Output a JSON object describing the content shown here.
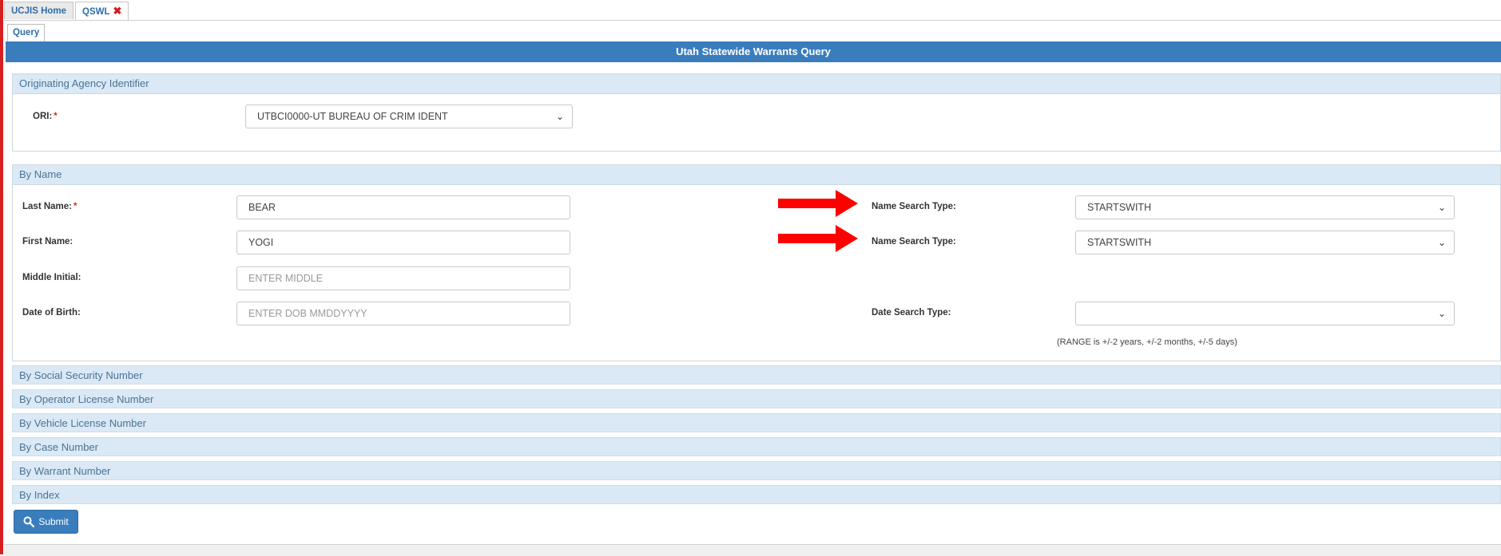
{
  "tabs": [
    {
      "label": "UCJIS Home"
    },
    {
      "label": "QSWL",
      "close": "✖"
    }
  ],
  "subtab": {
    "label": "Query"
  },
  "title": "Utah Statewide Warrants Query",
  "ori_section": {
    "header": "Originating Agency Identifier",
    "label": "ORI:",
    "value": "UTBCI0000-UT BUREAU OF CRIM IDENT"
  },
  "name_section": {
    "header": "By Name",
    "last_name": {
      "label": "Last Name:",
      "value": "BEAR"
    },
    "first_name": {
      "label": "First Name:",
      "value": "YOGI"
    },
    "middle": {
      "label": "Middle Initial:",
      "placeholder": "ENTER MIDDLE"
    },
    "dob": {
      "label": "Date of Birth:",
      "placeholder": "ENTER DOB MMDDYYYY"
    },
    "name_search_type_1": {
      "label": "Name Search Type:",
      "value": "STARTSWITH"
    },
    "name_search_type_2": {
      "label": "Name Search Type:",
      "value": "STARTSWITH"
    },
    "date_search_type": {
      "label": "Date Search Type:",
      "value": ""
    },
    "range_note": "(RANGE is +/-2 years, +/-2 months, +/-5 days)"
  },
  "collapsed_sections": [
    "By Social Security Number",
    "By Operator License Number",
    "By Vehicle License Number",
    "By Case Number",
    "By Warrant Number",
    "By Index"
  ],
  "submit_label": "Submit",
  "required_marker": "*",
  "colors": {
    "accent": "#3a7dbd",
    "annotation_arrow": "#ff0000"
  }
}
